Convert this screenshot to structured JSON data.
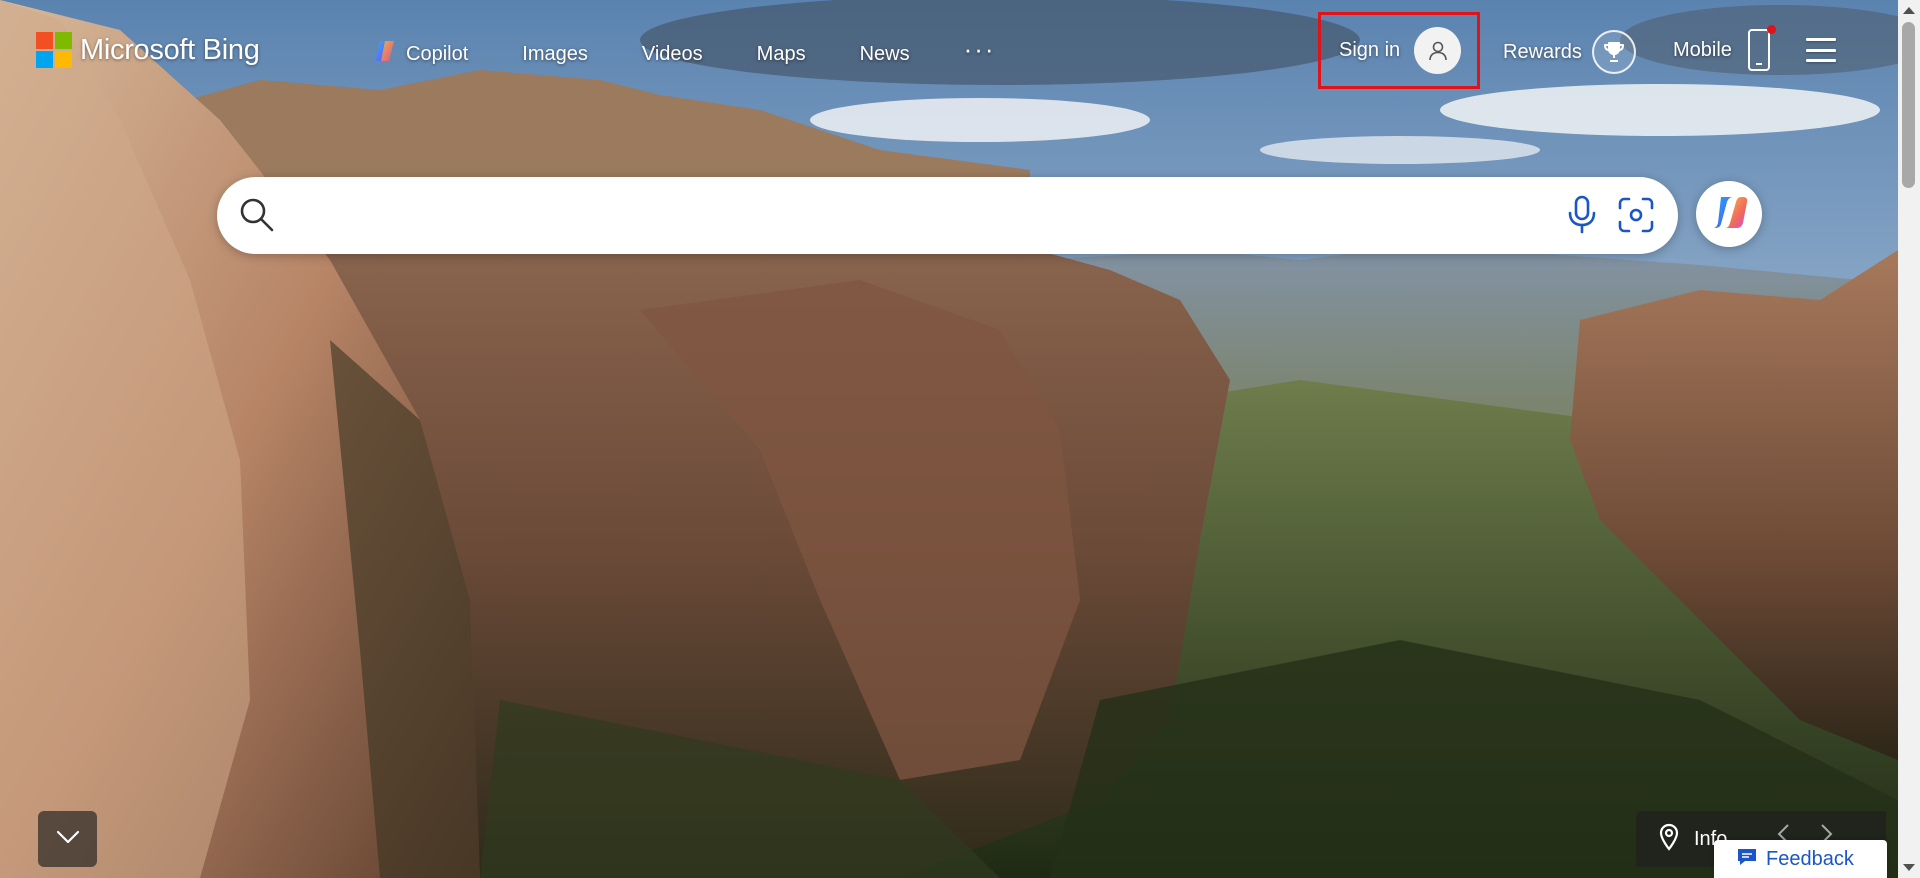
{
  "brand": {
    "name": "Microsoft Bing",
    "logo_colors": [
      "#f25022",
      "#7fba00",
      "#00a4ef",
      "#ffb900"
    ]
  },
  "nav": {
    "items": [
      {
        "label": "Copilot",
        "icon": "copilot-icon"
      },
      {
        "label": "Images"
      },
      {
        "label": "Videos"
      },
      {
        "label": "Maps"
      },
      {
        "label": "News"
      }
    ],
    "more_label": "···"
  },
  "account": {
    "sign_in_label": "Sign in",
    "avatar_icon": "person-icon",
    "highlight_color": "#e0131b"
  },
  "rewards": {
    "label": "Rewards",
    "icon": "trophy-icon"
  },
  "mobile": {
    "label": "Mobile",
    "icon": "phone-icon",
    "notification_dot_color": "#e0131b"
  },
  "menu": {
    "icon": "hamburger-icon"
  },
  "search": {
    "value": "",
    "placeholder": "",
    "icons": [
      "search-icon",
      "microphone-icon",
      "visual-search-icon"
    ]
  },
  "copilot_button": {
    "icon": "copilot-icon"
  },
  "bottom": {
    "scroll_icon": "chevron-down-icon",
    "info_label": "Info",
    "info_icon": "location-pin-icon",
    "feedback_label": "Feedback",
    "feedback_icon": "chat-bubble-icon",
    "link_color": "#1a56c9"
  }
}
